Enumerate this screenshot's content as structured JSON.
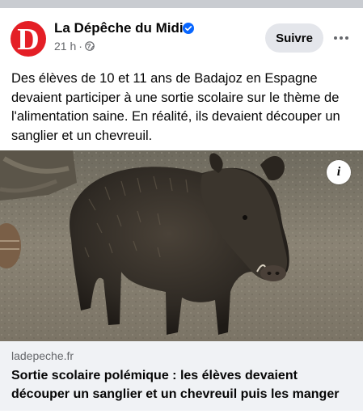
{
  "post": {
    "page_name": "La Dépêche du Midi",
    "avatar_letter": "D",
    "time": "21 h",
    "separator": "·",
    "follow_label": "Suivre",
    "text": "Des élèves de 10 et 11 ans de Badajoz en Espagne devaient participer à une sortie scolaire sur le thème de l'alimentation saine. En réalité, ils devaient découper un sanglier et un chevreuil."
  },
  "link": {
    "domain": "ladepeche.fr",
    "title": "Sortie scolaire polémique : les élèves devaient découper un sanglier et un chevreuil puis les manger"
  },
  "icons": {
    "verified": "verified-badge-icon",
    "globe": "globe-icon",
    "more": "more-options-icon",
    "info": "info-icon"
  },
  "colors": {
    "brand_red": "#e41f26",
    "verified_blue": "#0866ff",
    "secondary_text": "#65676b",
    "button_bg": "#e4e6eb",
    "card_bg": "#f0f2f5"
  }
}
